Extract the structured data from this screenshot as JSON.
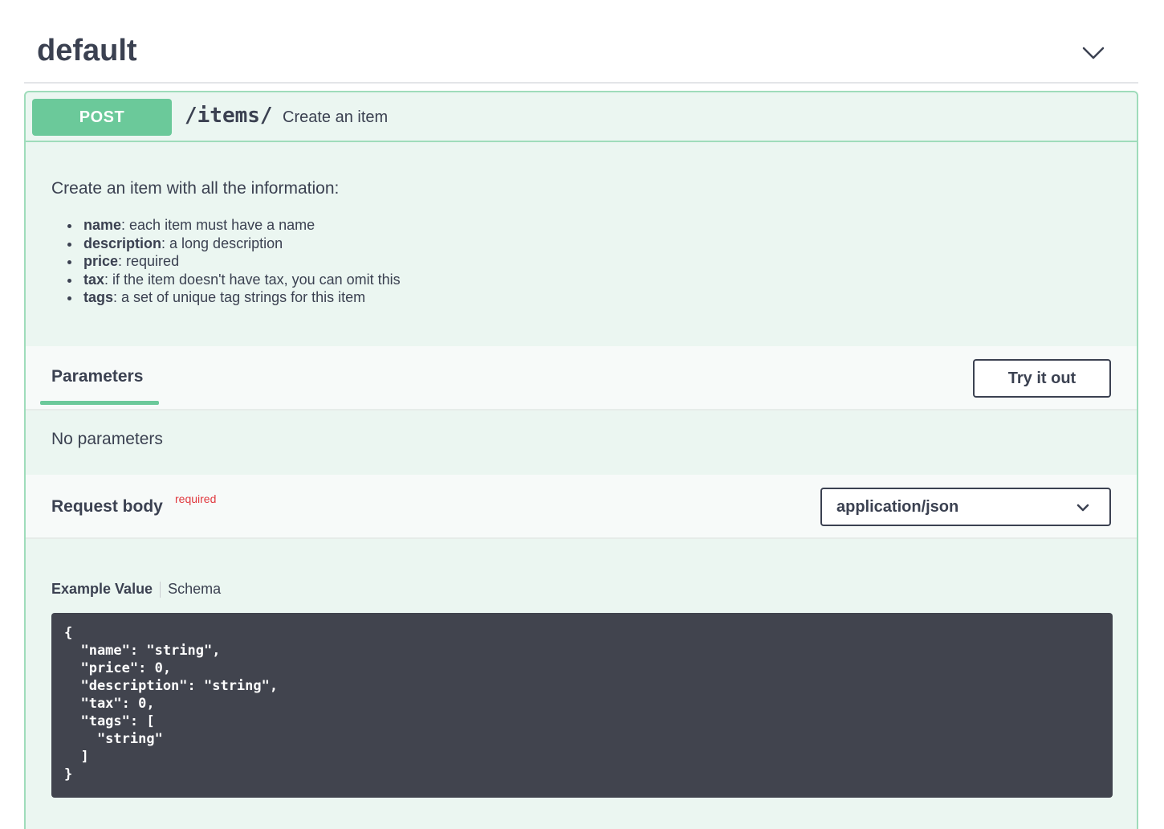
{
  "tag": {
    "title": "default",
    "chevron_icon": "chevron-down-icon"
  },
  "operation": {
    "method": "POST",
    "path": "/items/",
    "summary": "Create an item",
    "method_color": "#6bc99a",
    "description": {
      "intro": "Create an item with all the information:",
      "items": [
        {
          "term": "name",
          "text": ": each item must have a name"
        },
        {
          "term": "description",
          "text": ": a long description"
        },
        {
          "term": "price",
          "text": ": required"
        },
        {
          "term": "tax",
          "text": ": if the item doesn't have tax, you can omit this"
        },
        {
          "term": "tags",
          "text": ": a set of unique tag strings for this item"
        }
      ]
    },
    "parameters": {
      "tab_label": "Parameters",
      "try_button": "Try it out",
      "empty_text": "No parameters"
    },
    "request_body": {
      "title": "Request body",
      "required_label": "required",
      "content_type": "application/json",
      "example_tab": "Example Value",
      "schema_tab": "Schema",
      "example": "{\n  \"name\": \"string\",\n  \"price\": 0,\n  \"description\": \"string\",\n  \"tax\": 0,\n  \"tags\": [\n    \"string\"\n  ]\n}"
    }
  }
}
